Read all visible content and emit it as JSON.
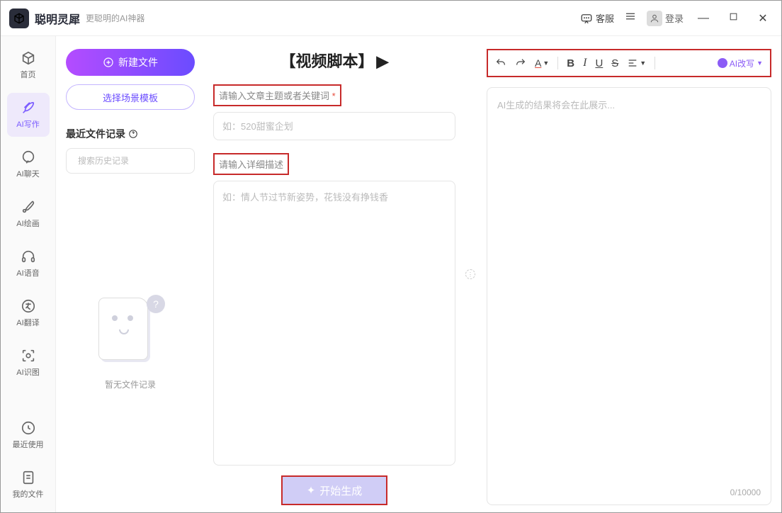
{
  "app": {
    "title": "聪明灵犀",
    "slogan": "更聪明的AI神器"
  },
  "titlebar": {
    "support": "客服",
    "login": "登录"
  },
  "sidebar": {
    "items": [
      {
        "label": "首页"
      },
      {
        "label": "AI写作"
      },
      {
        "label": "AI聊天"
      },
      {
        "label": "AI绘画"
      },
      {
        "label": "AI语音"
      },
      {
        "label": "AI翻译"
      },
      {
        "label": "AI识图"
      },
      {
        "label": "最近使用"
      },
      {
        "label": "我的文件"
      }
    ]
  },
  "left": {
    "new_file": "新建文件",
    "template": "选择场景模板",
    "recent_title": "最近文件记录",
    "search_placeholder": "搜索历史记录",
    "empty": "暂无文件记录"
  },
  "center": {
    "title": "【视频脚本】",
    "label1": "请输入文章主题或者关键词",
    "placeholder1": "如：520甜蜜企划",
    "label2": "请输入详细描述",
    "placeholder2": "如：情人节过节新姿势，花钱没有挣钱香",
    "generate": "开始生成"
  },
  "right": {
    "ai_rewrite": "AI改写",
    "output_placeholder": "AI生成的结果将会在此展示...",
    "char_count": "0/10000"
  }
}
